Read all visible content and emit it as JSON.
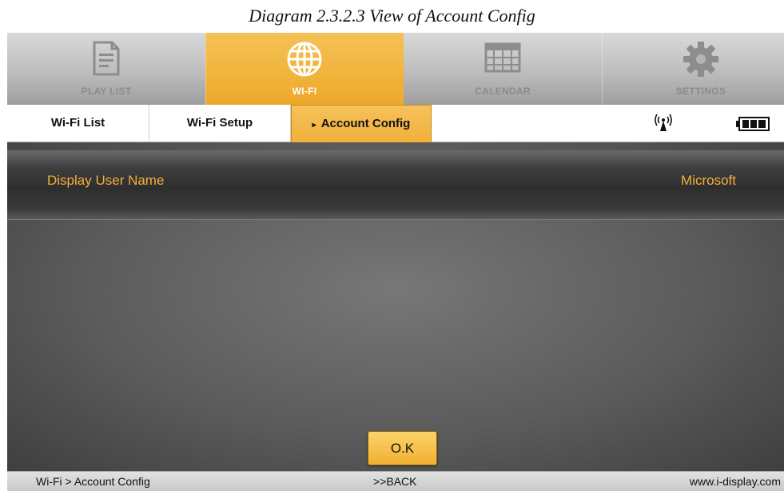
{
  "caption": "Diagram 2.3.2.3    View of Account Config",
  "top_nav": [
    {
      "label": "PLAY LIST",
      "icon": "document-icon",
      "active": false
    },
    {
      "label": "WI-FI",
      "icon": "globe-icon",
      "active": true
    },
    {
      "label": "CALENDAR",
      "icon": "calendar-icon",
      "active": false
    },
    {
      "label": "SETTINGS",
      "icon": "gear-icon",
      "active": false
    }
  ],
  "tabs": [
    {
      "label": "Wi-Fi List"
    },
    {
      "label": "Wi-Fi Setup"
    },
    {
      "label": "Account Config",
      "active": true,
      "marker": "▸"
    }
  ],
  "status_icons": [
    "wifi-signal-icon",
    "battery-icon"
  ],
  "content": {
    "row_label": "Display User Name",
    "row_value": "Microsoft",
    "ok_label": "O.K"
  },
  "footer": {
    "breadcrumb": "Wi-Fi > Account Config",
    "back": ">>BACK",
    "website": "www.i-display.com"
  },
  "colors": {
    "accent": "#f1b33a",
    "text_highlight": "#f4b03a"
  }
}
